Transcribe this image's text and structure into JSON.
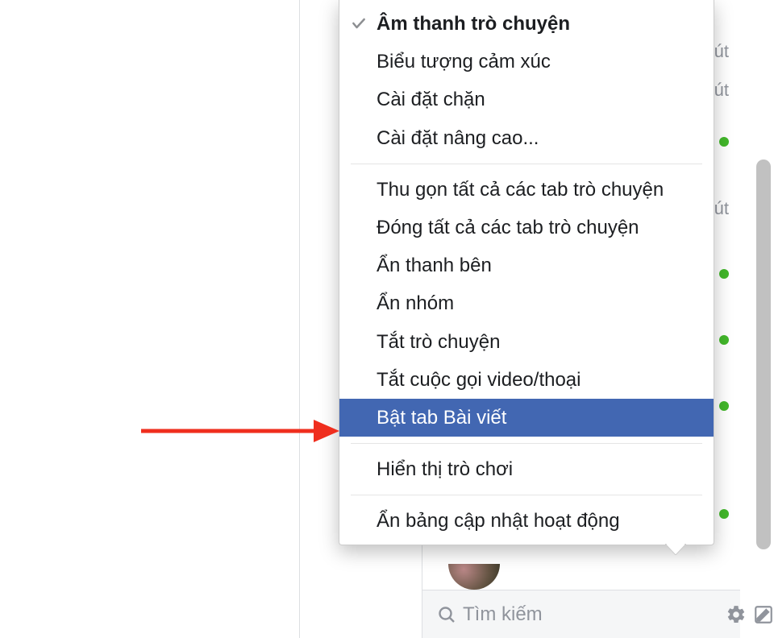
{
  "menu": {
    "section1": [
      {
        "label": "Âm thanh trò chuyện",
        "checked": true,
        "bold": true
      },
      {
        "label": "Biểu tượng cảm xúc"
      },
      {
        "label": "Cài đặt chặn"
      },
      {
        "label": "Cài đặt nâng cao..."
      }
    ],
    "section2": [
      {
        "label": "Thu gọn tất cả các tab trò chuyện"
      },
      {
        "label": "Đóng tất cả các tab trò chuyện"
      },
      {
        "label": "Ẩn thanh bên"
      },
      {
        "label": "Ẩn nhóm"
      },
      {
        "label": "Tắt trò chuyện"
      },
      {
        "label": "Tắt cuộc gọi video/thoại"
      },
      {
        "label": "Bật tab Bài viết",
        "selected": true
      }
    ],
    "section3": [
      {
        "label": "Hiển thị trò chơi"
      }
    ],
    "section4": [
      {
        "label": "Ẩn bảng cập nhật hoạt động"
      }
    ]
  },
  "sidebar": {
    "rows": [
      {
        "suffix": "út",
        "online": false
      },
      {
        "suffix": "út",
        "online": false
      },
      {
        "suffix": "",
        "online": true
      },
      {
        "suffix": "út",
        "online": false
      },
      {
        "suffix": "",
        "online": true
      },
      {
        "suffix": "",
        "online": true
      },
      {
        "suffix": "",
        "online": true
      },
      {
        "suffix": "",
        "online": false
      },
      {
        "suffix": "",
        "online": true
      }
    ]
  },
  "search": {
    "placeholder": "Tìm kiếm"
  },
  "icons": {
    "check": "✓",
    "search": "search-icon",
    "settings": "gear-icon",
    "compose": "compose-icon"
  },
  "colors": {
    "highlight": "#4267b2",
    "presence": "#42b72a",
    "arrow": "#ef2e1e"
  }
}
